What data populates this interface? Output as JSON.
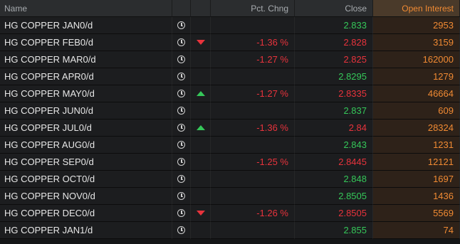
{
  "headers": {
    "name": "Name",
    "pct_chng": "Pct. Chng",
    "close": "Close",
    "open_interest": "Open Interest"
  },
  "colors": {
    "up": "#35c759",
    "down": "#e8333c",
    "accent": "#f08a33"
  },
  "rows": [
    {
      "name": "HG COPPER JAN0/d",
      "icon": "clock-icon",
      "arrow": "",
      "pct": "",
      "close": "2.833",
      "close_dir": "up",
      "oi": "2953"
    },
    {
      "name": "HG COPPER FEB0/d",
      "icon": "clock-icon",
      "arrow": "down",
      "pct": "-1.36 %",
      "close": "2.828",
      "close_dir": "down",
      "oi": "3159"
    },
    {
      "name": "HG COPPER MAR0/d",
      "icon": "clock-icon",
      "arrow": "",
      "pct": "-1.27 %",
      "close": "2.825",
      "close_dir": "down",
      "oi": "162000"
    },
    {
      "name": "HG COPPER APR0/d",
      "icon": "clock-icon",
      "arrow": "",
      "pct": "",
      "close": "2.8295",
      "close_dir": "up",
      "oi": "1279"
    },
    {
      "name": "HG COPPER MAY0/d",
      "icon": "clock-icon",
      "arrow": "up",
      "pct": "-1.27 %",
      "close": "2.8335",
      "close_dir": "down",
      "oi": "46664"
    },
    {
      "name": "HG COPPER JUN0/d",
      "icon": "clock-icon",
      "arrow": "",
      "pct": "",
      "close": "2.837",
      "close_dir": "up",
      "oi": "609"
    },
    {
      "name": "HG COPPER JUL0/d",
      "icon": "clock-icon",
      "arrow": "up",
      "pct": "-1.36 %",
      "close": "2.84",
      "close_dir": "down",
      "oi": "28324"
    },
    {
      "name": "HG COPPER AUG0/d",
      "icon": "clock-icon",
      "arrow": "",
      "pct": "",
      "close": "2.843",
      "close_dir": "up",
      "oi": "1231"
    },
    {
      "name": "HG COPPER SEP0/d",
      "icon": "clock-icon",
      "arrow": "",
      "pct": "-1.25 %",
      "close": "2.8445",
      "close_dir": "down",
      "oi": "12121"
    },
    {
      "name": "HG COPPER OCT0/d",
      "icon": "clock-icon",
      "arrow": "",
      "pct": "",
      "close": "2.848",
      "close_dir": "up",
      "oi": "1697"
    },
    {
      "name": "HG COPPER NOV0/d",
      "icon": "clock-icon",
      "arrow": "",
      "pct": "",
      "close": "2.8505",
      "close_dir": "up",
      "oi": "1436"
    },
    {
      "name": "HG COPPER DEC0/d",
      "icon": "clock-icon",
      "arrow": "down",
      "pct": "-1.26 %",
      "close": "2.8505",
      "close_dir": "down",
      "oi": "5569"
    },
    {
      "name": "HG COPPER JAN1/d",
      "icon": "clock-icon",
      "arrow": "",
      "pct": "",
      "close": "2.855",
      "close_dir": "up",
      "oi": "74"
    }
  ]
}
